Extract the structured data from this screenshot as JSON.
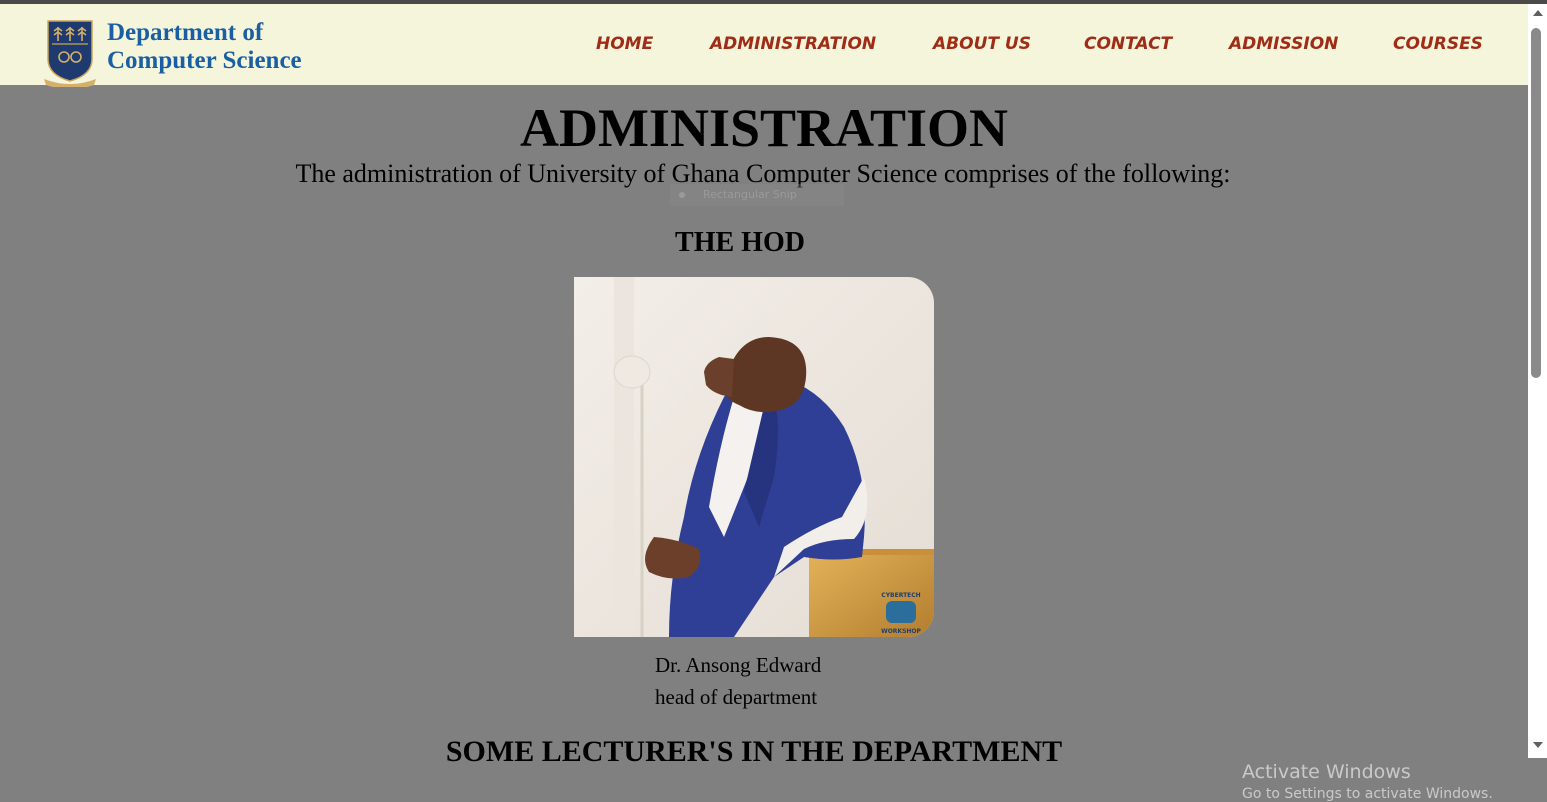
{
  "header": {
    "brand_line1": "Department of",
    "brand_line2": "Computer Science",
    "logo_icon": "university-crest-icon",
    "nav": [
      "HOME",
      "ADMINISTRATION",
      "ABOUT US",
      "CONTACT",
      "ADMISSION",
      "COURSES"
    ]
  },
  "main": {
    "title": "ADMINISTRATION",
    "intro": "The administration of University of Ghana Computer Science comprises of the following:",
    "hod_heading": "THE HOD",
    "hod_name": "Dr. Ansong Edward",
    "hod_role": "head of department",
    "lecturers_heading": "SOME LECTURER'S IN THE DEPARTMENT",
    "photo_badge_top": "CYBERTECH",
    "photo_badge_bottom": "WORKSHOP"
  },
  "overlay": {
    "snip_tooltip": "Rectangular Snip",
    "watermark_title": "Activate Windows",
    "watermark_subtitle": "Go to Settings to activate Windows."
  },
  "colors": {
    "header_bg": "#f5f5dc",
    "nav_text": "#a02c16",
    "brand_text": "#1a5fa3",
    "page_bg": "#808080"
  }
}
